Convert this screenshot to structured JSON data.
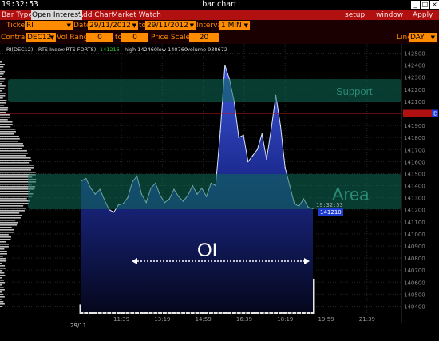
{
  "window": {
    "clock": "19:32:53",
    "title": "bar chart"
  },
  "menu": {
    "items": [
      "Bar Type",
      "Open Interest",
      "Add Chart",
      "Market Watch"
    ],
    "right": [
      "setup",
      "window",
      "Apply"
    ]
  },
  "controls": {
    "ticker_label": "Ticker",
    "ticker": "RI",
    "date_label": "Date",
    "date_from": "29/11/2012",
    "to_label": "to",
    "date_to": "29/11/2012",
    "interval_label": "Interval",
    "interval": "1 MIN",
    "contract_label": "Contract",
    "contract": "DEC12",
    "volrange_label": "Vol Range",
    "vol_from": "0",
    "vol_to_label": "to",
    "vol_to": "0",
    "pricescale_label": "Price Scale",
    "price_scale": "20",
    "line_label": "Line",
    "line": "DAY"
  },
  "info": {
    "symbol": "RI(DEC12) - RTS Index(RTS FORTS)",
    "last": "141216",
    "high": "high 142460",
    "low": "low 140760",
    "volume": "volume 938672"
  },
  "annotations": {
    "support": "Support",
    "area": "Area",
    "oi": "OI",
    "time_box": "19:32:53",
    "price_box": "141210",
    "marker": "D"
  },
  "colors": {
    "menu": "#b01010",
    "field": "#ff8c00",
    "band": "#0f6e57",
    "area_top": "#3c55d8",
    "tag": "#1e3cd0",
    "ref_line": "#c01818"
  },
  "chart_data": {
    "type": "area",
    "date_label": "29/11",
    "x_ticks": [
      "11:39",
      "13:19",
      "14:59",
      "16:39",
      "18:19",
      "19:59",
      "21:39"
    ],
    "y_ticks": [
      142500,
      142400,
      142300,
      142200,
      142100,
      142000,
      141900,
      141800,
      141700,
      141600,
      141500,
      141400,
      141300,
      141200,
      141100,
      141000,
      140900,
      140800,
      140700,
      140600,
      140500,
      140400
    ],
    "ylim": [
      140350,
      142550
    ],
    "series": [
      {
        "x": [
          0,
          0.02,
          0.04,
          0.06,
          0.08,
          0.1,
          0.12,
          0.14,
          0.16,
          0.18,
          0.2,
          0.22,
          0.24,
          0.26,
          0.28,
          0.3,
          0.32,
          0.34,
          0.36,
          0.38,
          0.4,
          0.42,
          0.44,
          0.46,
          0.48,
          0.5,
          0.52,
          0.54,
          0.56,
          0.58,
          0.6,
          0.62,
          0.64,
          0.66,
          0.68,
          0.7,
          0.72,
          0.74,
          0.76,
          0.78,
          0.8,
          0.82,
          0.84,
          0.86,
          0.88,
          0.9,
          0.92,
          0.94,
          0.96,
          0.98,
          1
        ],
        "values": [
          141440,
          141460,
          141380,
          141330,
          141370,
          141280,
          141200,
          141180,
          141240,
          141250,
          141300,
          141430,
          141480,
          141330,
          141260,
          141380,
          141420,
          141320,
          141260,
          141290,
          141370,
          141310,
          141270,
          141320,
          141400,
          141330,
          141380,
          141310,
          141420,
          141400,
          141850,
          142400,
          142280,
          142100,
          141800,
          141820,
          141600,
          141650,
          141700,
          141830,
          141620,
          141870,
          142150,
          141900,
          141550,
          141400,
          141250,
          141230,
          141290,
          141220,
          141210
        ]
      }
    ],
    "oi_values": [
      0.2,
      0.24,
      0.16,
      0.85,
      0.86,
      0.86,
      0.87,
      0.86,
      0.86,
      0.85,
      0.86,
      0.86,
      0.87,
      0.87,
      0.86,
      0.86,
      0.87,
      0.88,
      0.87,
      0.87,
      0.86,
      0.86,
      0.86,
      0.87,
      0.88,
      0.88,
      0.87,
      0.87,
      0.88,
      0.88,
      0.88,
      0.89,
      0.88,
      0.84,
      0.82,
      0.8,
      0.82,
      0.82,
      0.83,
      0.82,
      0.83,
      0.83,
      0.82,
      0.83,
      0.84,
      0.82,
      0.55,
      0.82,
      0.79,
      0.76,
      0.76
    ]
  }
}
